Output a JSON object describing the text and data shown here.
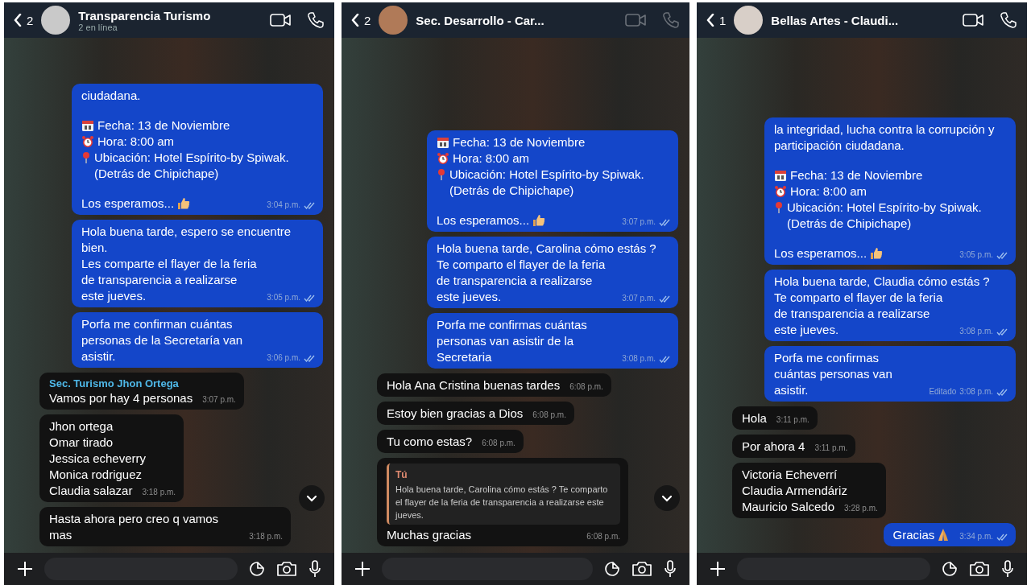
{
  "panels": [
    {
      "back_count": "2",
      "title": "Transparencia Turismo",
      "subtitle": "2 en línea",
      "calls_dimmed": false,
      "scroll_down_button": true,
      "messages": [
        {
          "kind": "outgoing",
          "paragraphs": [
            [
              {
                "kind": "plain",
                "text": "ciudadana."
              }
            ],
            [
              {
                "kind": "date",
                "text": "Fecha: 13 de Noviembre"
              },
              {
                "kind": "time",
                "text": "Hora: 8:00 am"
              },
              {
                "kind": "place",
                "text": "Ubicación: Hotel Espírito-by Spiwak. (Detrás de Chipichape)"
              }
            ],
            [
              {
                "kind": "closing",
                "text": "Los esperamos..."
              }
            ]
          ],
          "time": "3:04 p.m."
        },
        {
          "kind": "outgoing",
          "paragraphs": [
            [
              {
                "kind": "plain",
                "text": "Hola buena tarde, espero se encuentre bien."
              },
              {
                "kind": "plain",
                "text": "Les comparte el flayer de la feria de transparencia a realizarse este jueves."
              }
            ]
          ],
          "time": "3:05 p.m."
        },
        {
          "kind": "outgoing",
          "paragraphs": [
            [
              {
                "kind": "plain",
                "text": "Porfa me confirman cuántas personas de la Secretaría van asistir."
              }
            ]
          ],
          "time": "3:06 p.m."
        },
        {
          "kind": "incoming",
          "sender": "Sec. Turismo Jhon Ortega",
          "paragraphs": [
            [
              {
                "kind": "plain",
                "text": "Vamos por hay 4 personas"
              }
            ]
          ],
          "time": "3:07 p.m."
        },
        {
          "kind": "incoming",
          "paragraphs": [
            [
              {
                "kind": "plain",
                "text": "Jhon ortega"
              },
              {
                "kind": "plain",
                "text": "Omar tirado"
              },
              {
                "kind": "plain",
                "text": "Jessica echeverry"
              },
              {
                "kind": "plain",
                "text": "Monica rodriguez"
              },
              {
                "kind": "plain",
                "text": "Claudia salazar"
              }
            ]
          ],
          "time": "3:18 p.m."
        },
        {
          "kind": "incoming",
          "paragraphs": [
            [
              {
                "kind": "plain",
                "text": "Hasta ahora pero creo q vamos mas"
              }
            ]
          ],
          "time": "3:18 p.m."
        }
      ]
    },
    {
      "back_count": "2",
      "title": "Sec. Desarrollo - Car...",
      "calls_dimmed": true,
      "scroll_down_button": true,
      "messages": [
        {
          "kind": "outgoing",
          "paragraphs": [
            [
              {
                "kind": "date",
                "text": "Fecha: 13 de Noviembre"
              },
              {
                "kind": "time",
                "text": "Hora: 8:00 am"
              },
              {
                "kind": "place",
                "text": "Ubicación: Hotel Espírito-by Spiwak. (Detrás de Chipichape)"
              }
            ],
            [
              {
                "kind": "closing",
                "text": "Los esperamos..."
              }
            ]
          ],
          "time": "3:07 p.m."
        },
        {
          "kind": "outgoing",
          "paragraphs": [
            [
              {
                "kind": "plain",
                "text": "Hola buena tarde, Carolina cómo estás ?"
              },
              {
                "kind": "plain",
                "text": "Te comparto el flayer de la feria de transparencia a realizarse este jueves."
              }
            ]
          ],
          "time": "3:07 p.m."
        },
        {
          "kind": "outgoing",
          "paragraphs": [
            [
              {
                "kind": "plain",
                "text": "Porfa me confirmas cuántas personas van asistir de la Secretaria"
              }
            ]
          ],
          "time": "3:08 p.m."
        },
        {
          "kind": "incoming",
          "paragraphs": [
            [
              {
                "kind": "plain",
                "text": "Hola Ana Cristina buenas tardes"
              }
            ]
          ],
          "time": "6:08 p.m."
        },
        {
          "kind": "incoming",
          "paragraphs": [
            [
              {
                "kind": "plain",
                "text": "Estoy bien gracias a Dios"
              }
            ]
          ],
          "time": "6:08 p.m."
        },
        {
          "kind": "incoming",
          "paragraphs": [
            [
              {
                "kind": "plain",
                "text": "Tu como estas?"
              }
            ]
          ],
          "time": "6:08 p.m."
        },
        {
          "kind": "incoming",
          "quote": {
            "author": "Tú",
            "text": "Hola buena tarde, Carolina cómo estás ? Te comparto el flayer de la feria de transparencia a realizarse este jueves."
          },
          "paragraphs": [
            [
              {
                "kind": "plain",
                "text": "Muchas gracias"
              }
            ]
          ],
          "time": "6:08 p.m."
        }
      ]
    },
    {
      "back_count": "1",
      "title": "Bellas Artes - Claudi...",
      "calls_dimmed": false,
      "scroll_down_button": false,
      "messages": [
        {
          "kind": "outgoing",
          "paragraphs": [
            [
              {
                "kind": "plain",
                "text": "la integridad, lucha contra la corrupción y participación ciudadana."
              }
            ],
            [
              {
                "kind": "date",
                "text": "Fecha: 13 de Noviembre"
              },
              {
                "kind": "time",
                "text": "Hora: 8:00 am"
              },
              {
                "kind": "place",
                "text": "Ubicación: Hotel Espírito-by Spiwak. (Detrás de Chipichape)"
              }
            ],
            [
              {
                "kind": "closing",
                "text": "Los esperamos..."
              }
            ]
          ],
          "time": "3:05 p.m."
        },
        {
          "kind": "outgoing",
          "paragraphs": [
            [
              {
                "kind": "plain",
                "text": "Hola buena tarde, Claudia cómo estás ?"
              },
              {
                "kind": "plain",
                "text": "Te comparto el flayer de la feria de transparencia a realizarse este jueves."
              }
            ]
          ],
          "time": "3:08 p.m."
        },
        {
          "kind": "outgoing",
          "edited": "Editado",
          "paragraphs": [
            [
              {
                "kind": "plain",
                "text": "Porfa me confirmas cuántas personas van asistir."
              }
            ]
          ],
          "time": "3:08 p.m."
        },
        {
          "kind": "incoming",
          "paragraphs": [
            [
              {
                "kind": "plain",
                "text": "Hola"
              }
            ]
          ],
          "time": "3:11 p.m."
        },
        {
          "kind": "incoming",
          "paragraphs": [
            [
              {
                "kind": "plain",
                "text": "Por ahora 4"
              }
            ]
          ],
          "time": "3:11 p.m."
        },
        {
          "kind": "incoming",
          "paragraphs": [
            [
              {
                "kind": "plain",
                "text": "Victoria Echeverrí"
              },
              {
                "kind": "plain",
                "text": "Claudia Armendáriz"
              },
              {
                "kind": "plain",
                "text": "Mauricio Salcedo"
              }
            ]
          ],
          "time": "3:28 p.m."
        },
        {
          "kind": "outgoing",
          "paragraphs": [
            [
              {
                "kind": "thanks",
                "text": "Gracias"
              }
            ]
          ],
          "time": "3:34 p.m."
        }
      ]
    }
  ]
}
